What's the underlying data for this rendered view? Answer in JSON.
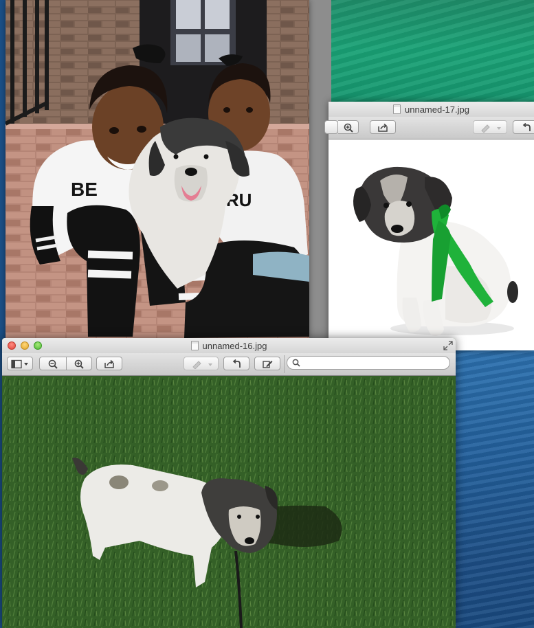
{
  "windows": {
    "front": {
      "title": "unnamed-16.jpg"
    },
    "back": {
      "title": "unnamed-17.jpg"
    }
  },
  "photo": {
    "shirt_text_left": "BE",
    "shirt_text_right": "TRU"
  },
  "colors": {
    "desktop_green": "#1aa276",
    "desktop_blue": "#23609c",
    "ribbon_green": "#1fb23a",
    "grass": "#3d6a2e"
  },
  "icons": [
    "sidebar-icon",
    "zoom-out-icon",
    "zoom-in-icon",
    "share-icon",
    "markup-pen-icon",
    "rotate-icon",
    "edit-toolbox-icon",
    "search-icon",
    "fullscreen-icon",
    "document-icon"
  ]
}
